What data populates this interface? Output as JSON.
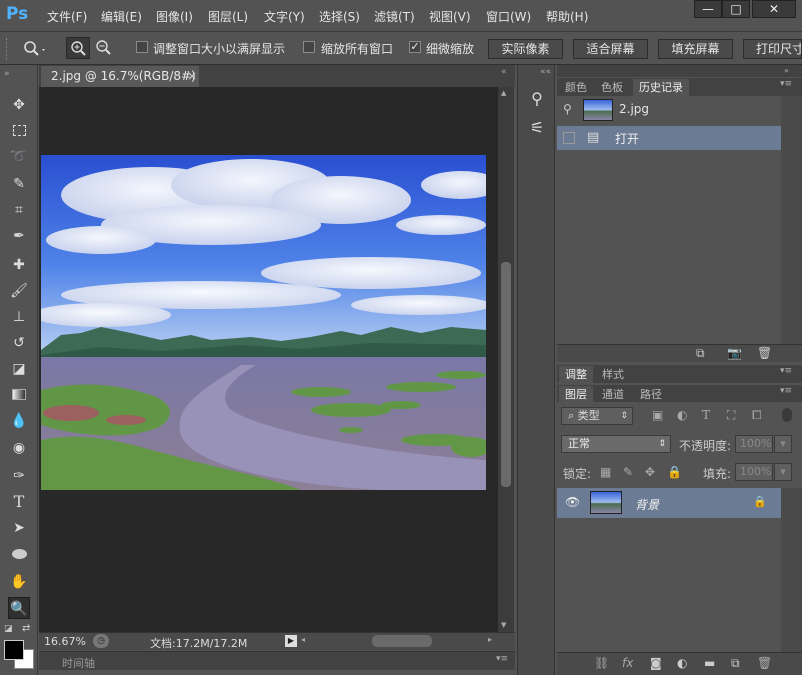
{
  "app": {
    "logo": "Ps"
  },
  "menu": [
    "文件(F)",
    "编辑(E)",
    "图像(I)",
    "图层(L)",
    "文字(Y)",
    "选择(S)",
    "滤镜(T)",
    "视图(V)",
    "窗口(W)",
    "帮助(H)"
  ],
  "window_controls": {
    "minimize": "—",
    "restore": "□",
    "close": "✕"
  },
  "options": {
    "resize_windows_label": "调整窗口大小以满屏显示",
    "resize_windows_checked": false,
    "zoom_all_label": "缩放所有窗口",
    "zoom_all_checked": false,
    "scrubby_zoom_label": "细微缩放",
    "scrubby_zoom_checked": true,
    "actual_pixels": "实际像素",
    "fit_screen": "适合屏幕",
    "fill_screen": "填充屏幕",
    "print_size": "打印尺寸"
  },
  "document": {
    "tab_title": "2.jpg @ 16.7%(RGB/8#)",
    "tab_close": "×",
    "zoom": "16.67%",
    "doc_info": "文档:17.2M/17.2M",
    "timeline_label": "时间轴"
  },
  "history_panel": {
    "tabs": [
      "颜色",
      "色板",
      "历史记录"
    ],
    "active_tab": "历史记录",
    "snapshot_name": "2.jpg",
    "states": [
      "打开"
    ]
  },
  "adjust_panel": {
    "tabs": [
      "调整",
      "样式"
    ],
    "active_tab": "调整"
  },
  "layers_panel": {
    "tabs": [
      "图层",
      "通道",
      "路径"
    ],
    "active_tab": "图层",
    "filter_kind": "类型",
    "blend_mode": "正常",
    "opacity_label": "不透明度:",
    "opacity_value": "100%",
    "lock_label": "锁定:",
    "fill_label": "填充:",
    "fill_value": "100%",
    "layers": [
      {
        "name": "背景",
        "locked": true,
        "visible": true
      }
    ]
  },
  "colors": {
    "accent_selection": "#6b7b93",
    "ps_blue": "#4fb3ff"
  }
}
